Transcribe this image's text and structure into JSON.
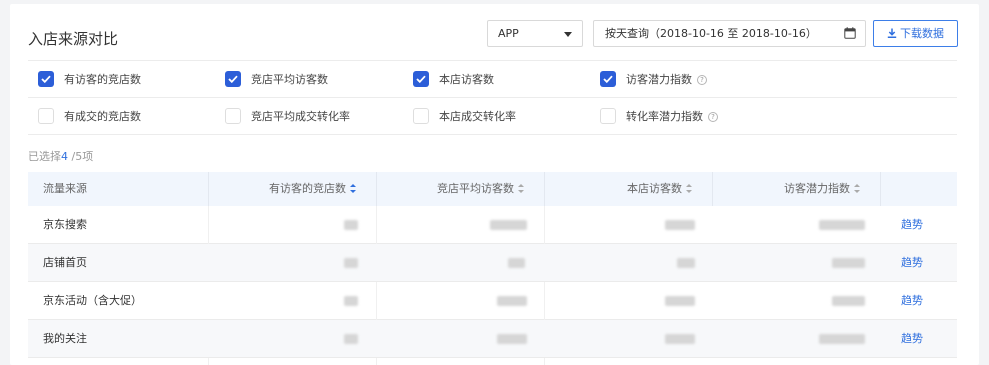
{
  "header": {
    "title": "入店来源对比",
    "platform_select": {
      "value": "APP"
    },
    "date_range": {
      "value": "按天查询（2018-10-16 至 2018-10-16）"
    },
    "download_label": "下载数据"
  },
  "metrics": {
    "row1": [
      {
        "label": "有访客的竞店数",
        "checked": true,
        "help": false
      },
      {
        "label": "竞店平均访客数",
        "checked": true,
        "help": false
      },
      {
        "label": "本店访客数",
        "checked": true,
        "help": false
      },
      {
        "label": "访客潜力指数",
        "checked": true,
        "help": true
      }
    ],
    "row2": [
      {
        "label": "有成交的竞店数",
        "checked": false,
        "help": false
      },
      {
        "label": "竞店平均成交转化率",
        "checked": false,
        "help": false
      },
      {
        "label": "本店成交转化率",
        "checked": false,
        "help": false
      },
      {
        "label": "转化率潜力指数",
        "checked": false,
        "help": true
      }
    ],
    "help_glyph": "?"
  },
  "selection": {
    "prefix": "已选择",
    "count": "4",
    "suffix": " /5项"
  },
  "table": {
    "columns": [
      "流量来源",
      "有访客的竞店数",
      "竞店平均访客数",
      "本店访客数",
      "访客潜力指数"
    ],
    "rows": [
      {
        "source": "京东搜索",
        "action": "趋势"
      },
      {
        "source": "店铺首页",
        "action": "趋势"
      },
      {
        "source": "京东活动（含大促）",
        "action": "趋势"
      },
      {
        "source": "我的关注",
        "action": "趋势"
      }
    ]
  },
  "colors": {
    "accent": "#2f6fde",
    "checkbox": "#2c5ed8",
    "header_bg": "#f1f6fd",
    "alt_row": "#f7f8fa"
  },
  "icons": [
    "chevron-down-icon",
    "calendar-icon",
    "download-icon",
    "check-icon",
    "help-icon",
    "sort-icon"
  ]
}
